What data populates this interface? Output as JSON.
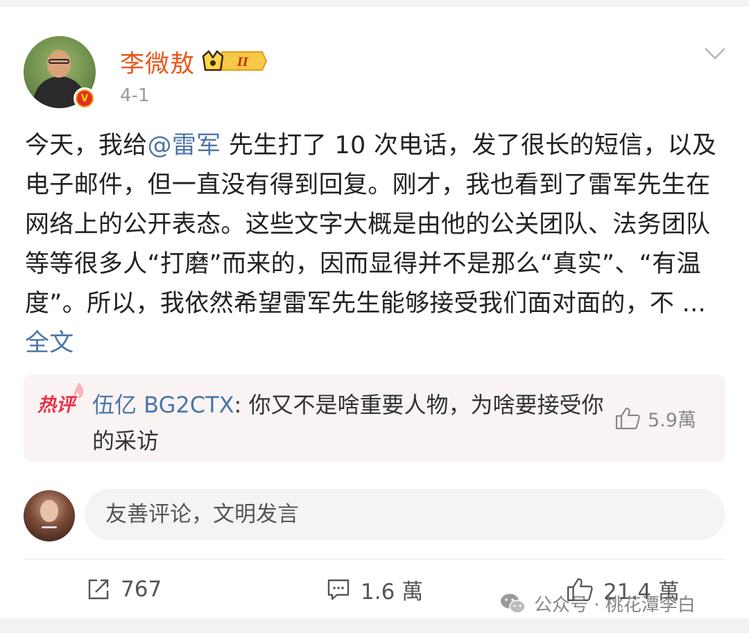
{
  "author": {
    "name": "李微敖",
    "rank_badge": "II",
    "verified_mark": "V",
    "date": "4-1"
  },
  "post": {
    "text_before_mention": "今天，我给",
    "mention": "@雷军",
    "text_after_mention": " 先生打了 10 次电话，发了很长的短信，以及电子邮件，但一直没有得到回复。刚才，我也看到了雷军先生在网络上的公开表态。这些文字大概是由他的公关团队、法务团队等等很多人“打磨”而来的，因而显得并不是那么“真实”、“有温度”。所以，我依然希望雷军先生能够接受我们面对面的，不 ...",
    "full_text_link": "全文"
  },
  "hot_comment": {
    "tag": "热评",
    "user": "伍亿 BG2CTX",
    "text": ": 你又不是啥重要人物，为啥要接受你的采访",
    "likes": "5.9萬"
  },
  "comment_box": {
    "placeholder": "友善评论，文明发言"
  },
  "actions": {
    "reposts": "767",
    "comments": "1.6 萬",
    "likes": "21.4 萬"
  },
  "watermark": "公众号 · 桃花潭李白",
  "icons": {
    "more": "chevron-down-icon",
    "repost": "share-icon",
    "comment": "comment-icon",
    "like": "thumbs-up-icon",
    "wechat": "wechat-icon"
  },
  "colors": {
    "username": "#e8561c",
    "link": "#4a76a8",
    "hot_tag": "#e8334a",
    "hot_bg": "#faf3f3"
  }
}
